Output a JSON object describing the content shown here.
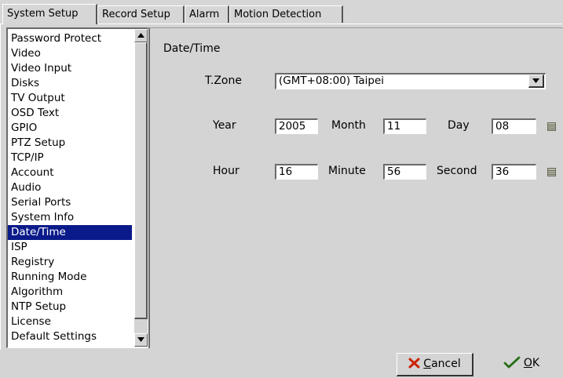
{
  "tabs": [
    {
      "label": "System Setup",
      "active": true
    },
    {
      "label": "Record Setup",
      "active": false
    },
    {
      "label": "Alarm",
      "active": false
    },
    {
      "label": "Motion Detection",
      "active": false
    }
  ],
  "menu": {
    "items": [
      "Password Protect",
      "Video",
      "Video Input",
      "Disks",
      "TV Output",
      "OSD Text",
      "GPIO",
      "PTZ Setup",
      "TCP/IP",
      "Account",
      "Audio",
      "Serial Ports",
      "System Info",
      "Date/Time",
      "ISP",
      "Registry",
      "Running Mode",
      "Algorithm",
      "NTP Setup",
      "License",
      "Default Settings"
    ],
    "selected": "Date/Time"
  },
  "section": {
    "title": "Date/Time"
  },
  "timezone": {
    "label": "T.Zone",
    "value": "(GMT+08:00) Taipei"
  },
  "date": {
    "year_label": "Year",
    "year": "2005",
    "month_label": "Month",
    "month": "11",
    "day_label": "Day",
    "day": "08"
  },
  "time": {
    "hour_label": "Hour",
    "hour": "16",
    "minute_label": "Minute",
    "minute": "56",
    "second_label": "Second",
    "second": "36"
  },
  "buttons": {
    "cancel_mnemonic": "C",
    "cancel_rest": "ancel",
    "ok_mnemonic": "O",
    "ok_rest": "K"
  },
  "icons": {
    "up": "arrow-up-icon",
    "down": "arrow-down-icon",
    "combo": "chevron-down-icon",
    "calendar": "calendar-icon",
    "cancel": "cross-icon",
    "ok": "checkmark-icon"
  },
  "colors": {
    "selection": "#0a1a8a",
    "cancel_icon": "#cc2200",
    "ok_icon": "#3a8a2a"
  }
}
